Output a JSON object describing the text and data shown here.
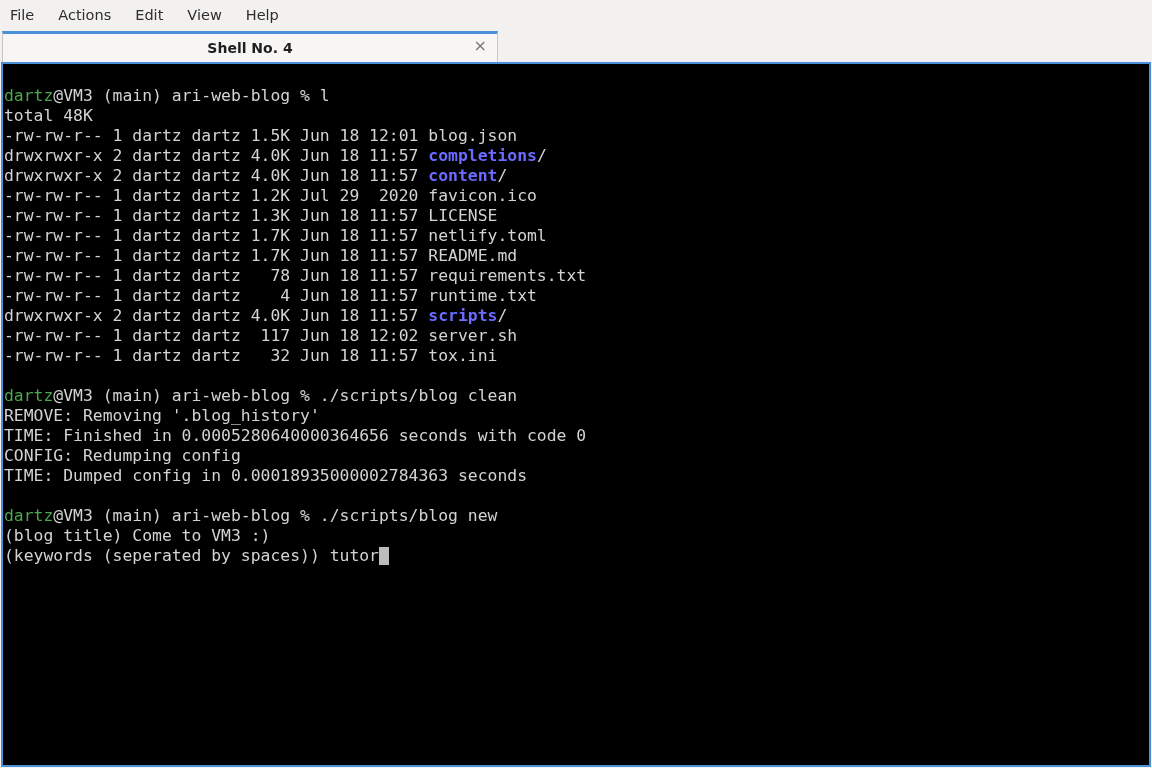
{
  "menu": [
    "File",
    "Actions",
    "Edit",
    "View",
    "Help"
  ],
  "tabs": [
    {
      "label": "Shell No. 4",
      "close": "×",
      "selected": true
    }
  ],
  "terminal": {
    "cursor": true,
    "blocks": [
      [
        [
          {
            "kind": "user",
            "text": "dartz"
          },
          {
            "kind": "plain",
            "text": "@VM3 (main) ari-web-blog % l"
          }
        ],
        [
          {
            "kind": "plain",
            "text": "total 48K"
          }
        ],
        [
          {
            "kind": "plain",
            "text": "-rw-rw-r-- 1 dartz dartz 1.5K Jun 18 12:01 blog.json"
          }
        ],
        [
          {
            "kind": "plain",
            "text": "drwxrwxr-x 2 dartz dartz 4.0K Jun 18 11:57 "
          },
          {
            "kind": "dir",
            "text": "completions"
          },
          {
            "kind": "plain",
            "text": "/"
          }
        ],
        [
          {
            "kind": "plain",
            "text": "drwxrwxr-x 2 dartz dartz 4.0K Jun 18 11:57 "
          },
          {
            "kind": "dir",
            "text": "content"
          },
          {
            "kind": "plain",
            "text": "/"
          }
        ],
        [
          {
            "kind": "plain",
            "text": "-rw-rw-r-- 1 dartz dartz 1.2K Jul 29  2020 favicon.ico"
          }
        ],
        [
          {
            "kind": "plain",
            "text": "-rw-rw-r-- 1 dartz dartz 1.3K Jun 18 11:57 LICENSE"
          }
        ],
        [
          {
            "kind": "plain",
            "text": "-rw-rw-r-- 1 dartz dartz 1.7K Jun 18 11:57 netlify.toml"
          }
        ],
        [
          {
            "kind": "plain",
            "text": "-rw-rw-r-- 1 dartz dartz 1.7K Jun 18 11:57 README.md"
          }
        ],
        [
          {
            "kind": "plain",
            "text": "-rw-rw-r-- 1 dartz dartz   78 Jun 18 11:57 requirements.txt"
          }
        ],
        [
          {
            "kind": "plain",
            "text": "-rw-rw-r-- 1 dartz dartz    4 Jun 18 11:57 runtime.txt"
          }
        ],
        [
          {
            "kind": "plain",
            "text": "drwxrwxr-x 2 dartz dartz 4.0K Jun 18 11:57 "
          },
          {
            "kind": "dir",
            "text": "scripts"
          },
          {
            "kind": "plain",
            "text": "/"
          }
        ],
        [
          {
            "kind": "plain",
            "text": "-rw-rw-r-- 1 dartz dartz  117 Jun 18 12:02 server.sh"
          }
        ],
        [
          {
            "kind": "plain",
            "text": "-rw-rw-r-- 1 dartz dartz   32 Jun 18 11:57 tox.ini"
          }
        ]
      ],
      [
        [
          {
            "kind": "user",
            "text": "dartz"
          },
          {
            "kind": "plain",
            "text": "@VM3 (main) ari-web-blog % ./scripts/blog clean"
          }
        ],
        [
          {
            "kind": "plain",
            "text": "REMOVE: Removing '.blog_history'"
          }
        ],
        [
          {
            "kind": "plain",
            "text": "TIME: Finished in 0.0005280640000364656 seconds with code 0"
          }
        ],
        [
          {
            "kind": "plain",
            "text": "CONFIG: Redumping config"
          }
        ],
        [
          {
            "kind": "plain",
            "text": "TIME: Dumped config in 0.00018935000002784363 seconds"
          }
        ]
      ],
      [
        [
          {
            "kind": "user",
            "text": "dartz"
          },
          {
            "kind": "plain",
            "text": "@VM3 (main) ari-web-blog % ./scripts/blog new"
          }
        ],
        [
          {
            "kind": "plain",
            "text": "(blog title) Come to VM3 :)"
          }
        ],
        [
          {
            "kind": "plain",
            "text": "(keywords (seperated by spaces)) tutor"
          }
        ]
      ]
    ]
  }
}
